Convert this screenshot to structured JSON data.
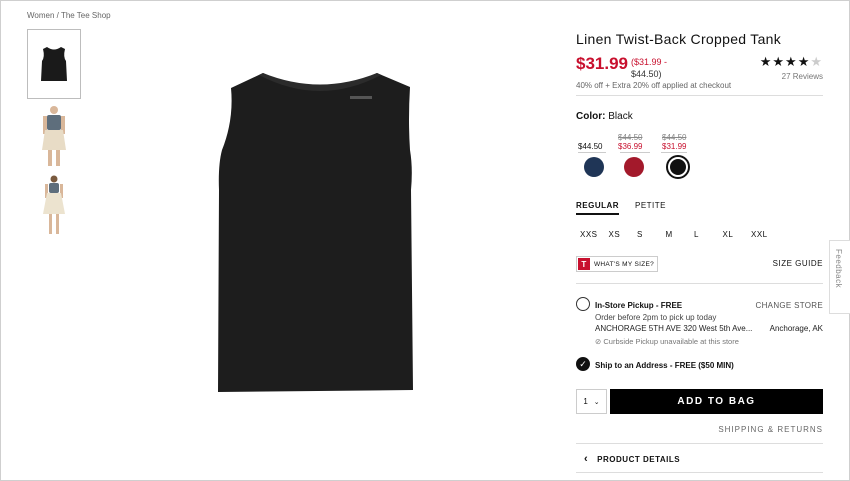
{
  "breadcrumb": "Women / The Tee Shop",
  "product": {
    "title": "Linen Twist-Back Cropped Tank",
    "price_now": "$31.99",
    "price_range_sale": "($31.99 -",
    "price_range_orig": "$44.50)",
    "rating": 4,
    "rating_max": 5,
    "reviews": "27 Reviews",
    "promo": "40% off + Extra 20% off applied at checkout"
  },
  "color": {
    "label": "Color:",
    "selected": "Black",
    "swatches": [
      {
        "name": "navy",
        "hex": "#1f3556",
        "price": "$44.50",
        "strike": "",
        "sale": ""
      },
      {
        "name": "red",
        "hex": "#a3192b",
        "price": "",
        "strike": "$44.50",
        "sale": "$36.99"
      },
      {
        "name": "black",
        "hex": "#111111",
        "price": "",
        "strike": "$44.50",
        "sale": "$31.99"
      }
    ]
  },
  "fit_tabs": [
    "REGULAR",
    "PETITE"
  ],
  "sizes": [
    "XXS",
    "XS",
    "S",
    "M",
    "L",
    "XL",
    "XXL"
  ],
  "whats_my_size": "WHAT'S MY SIZE?",
  "whats_my_size_icon": "T",
  "size_guide": "SIZE GUIDE",
  "pickup": {
    "title": "In-Store Pickup - FREE",
    "change_store": "CHANGE STORE",
    "line1": "Order before 2pm to pick up today",
    "store": "ANCHORAGE 5TH AVE 320 West 5th Ave...",
    "city": "Anchorage, AK",
    "note": "Curbside Pickup unavailable at this store"
  },
  "ship": {
    "title": "Ship to an Address - FREE ($50 MIN)"
  },
  "qty": "1",
  "add_to_bag": "ADD TO BAG",
  "shipping_returns": "SHIPPING & RETURNS",
  "product_details": "PRODUCT DETAILS",
  "feedback": "Feedback",
  "colors": {
    "sale_red": "#c8102e",
    "black": "#000000"
  }
}
